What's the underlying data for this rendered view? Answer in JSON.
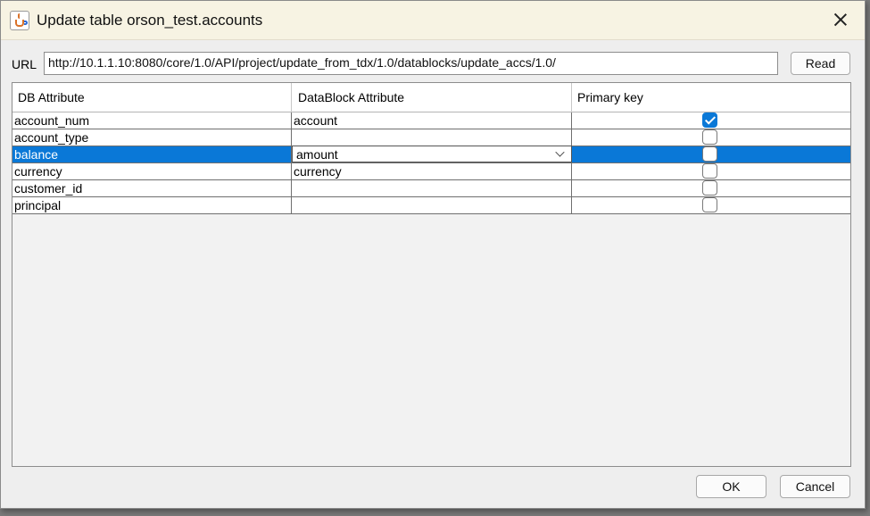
{
  "window": {
    "title": "Update table orson_test.accounts"
  },
  "url": {
    "label": "URL",
    "value": "http://10.1.1.10:8080/core/1.0/API/project/update_from_tdx/1.0/datablocks/update_accs/1.0/",
    "read_label": "Read"
  },
  "table": {
    "columns": [
      "DB Attribute",
      "DataBlock Attribute",
      "Primary key"
    ],
    "rows": [
      {
        "db_attribute": "account_num",
        "datablock_attribute": "account",
        "primary_key": true,
        "selected": false
      },
      {
        "db_attribute": "account_type",
        "datablock_attribute": "",
        "primary_key": false,
        "selected": false
      },
      {
        "db_attribute": "balance",
        "datablock_attribute": "amount",
        "primary_key": false,
        "selected": true,
        "editing": true
      },
      {
        "db_attribute": "currency",
        "datablock_attribute": "currency",
        "primary_key": false,
        "selected": false
      },
      {
        "db_attribute": "customer_id",
        "datablock_attribute": "",
        "primary_key": false,
        "selected": false
      },
      {
        "db_attribute": "principal",
        "datablock_attribute": "",
        "primary_key": false,
        "selected": false
      }
    ]
  },
  "buttons": {
    "ok": "OK",
    "cancel": "Cancel"
  },
  "icons": {
    "app": "java-icon",
    "close": "close-icon",
    "combo": "chevron-down-icon"
  },
  "colors": {
    "selection": "#0a78d7",
    "titlebar": "#f7f3e3"
  }
}
